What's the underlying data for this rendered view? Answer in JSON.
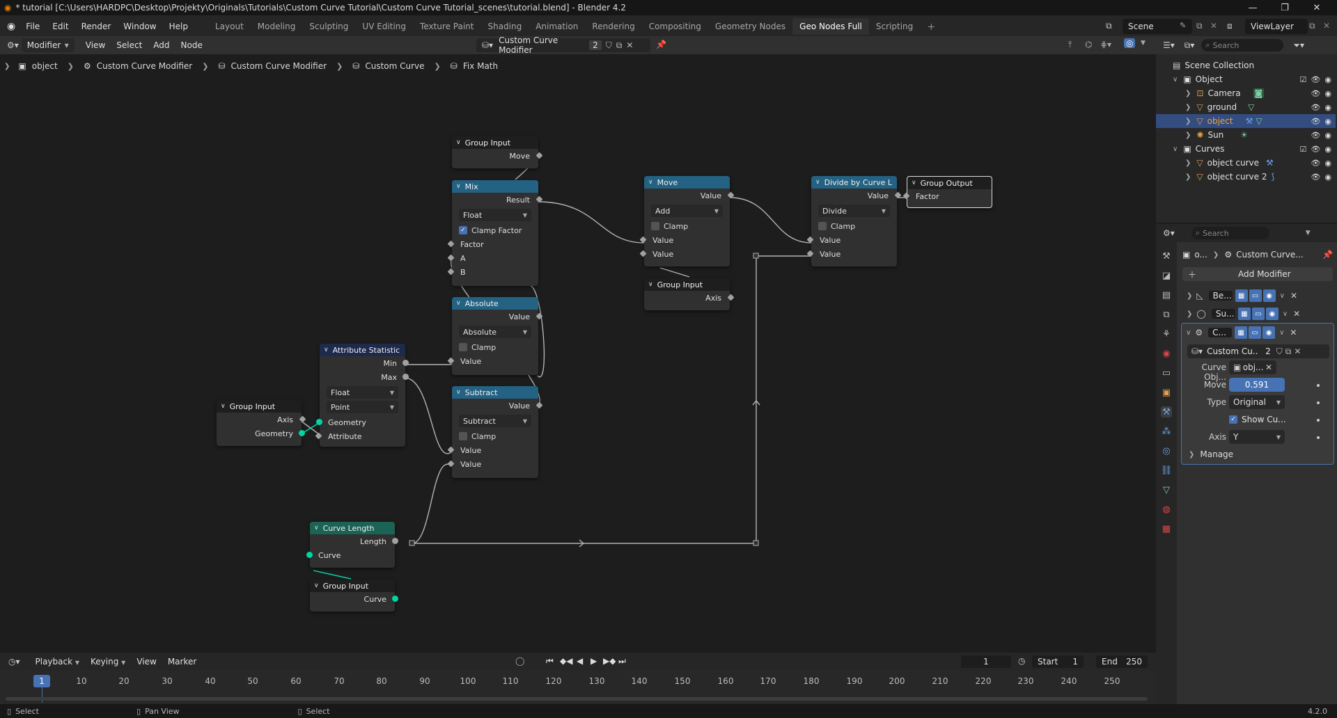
{
  "window": {
    "title": "* tutorial [C:\\Users\\HARDPC\\Desktop\\Projekty\\Originals\\Tutorials\\Custom Curve Tutorial\\Custom Curve Tutorial_scenes\\tutorial.blend] - Blender 4.2"
  },
  "menu": [
    "File",
    "Edit",
    "Render",
    "Window",
    "Help"
  ],
  "workspaces": [
    "Layout",
    "Modeling",
    "Sculpting",
    "UV Editing",
    "Texture Paint",
    "Shading",
    "Animation",
    "Rendering",
    "Compositing",
    "Geometry Nodes",
    "Geo Nodes Full",
    "Scripting"
  ],
  "active_workspace": "Geo Nodes Full",
  "topbar": {
    "scene": "Scene",
    "viewlayer": "ViewLayer"
  },
  "editor_header": {
    "mode": "Modifier",
    "menus": [
      "View",
      "Select",
      "Add",
      "Node"
    ],
    "tree_name": "Custom Curve Modifier",
    "users": "2"
  },
  "breadcrumb": [
    "object",
    "Custom Curve Modifier",
    "Custom Curve Modifier",
    "Custom Curve",
    "Fix Math"
  ],
  "nodes": {
    "group_input_top": {
      "title": "Group Input",
      "out": "Move"
    },
    "mix": {
      "title": "Mix",
      "out": "Result",
      "type": "Float",
      "clamp_factor": "Clamp Factor",
      "in_factor": "Factor",
      "in_a": "A",
      "in_b": "B"
    },
    "absolute": {
      "title": "Absolute",
      "out": "Value",
      "op": "Absolute",
      "clamp": "Clamp",
      "in": "Value"
    },
    "subtract": {
      "title": "Subtract",
      "out": "Value",
      "op": "Subtract",
      "clamp": "Clamp",
      "in1": "Value",
      "in2": "Value"
    },
    "attr_stat": {
      "title": "Attribute Statistic",
      "min": "Min",
      "max": "Max",
      "type": "Float",
      "domain": "Point",
      "in_geo": "Geometry",
      "in_attr": "Attribute"
    },
    "group_input_left": {
      "title": "Group Input",
      "axis": "Axis",
      "geo": "Geometry"
    },
    "move": {
      "title": "Move",
      "out": "Value",
      "op": "Add",
      "clamp": "Clamp",
      "in1": "Value",
      "in2": "Value"
    },
    "group_input_axis": {
      "title": "Group Input",
      "out": "Axis"
    },
    "divide": {
      "title": "Divide by Curve L",
      "out": "Value",
      "op": "Divide",
      "clamp": "Clamp",
      "in1": "Value",
      "in2": "Value"
    },
    "group_output": {
      "title": "Group Output",
      "in": "Factor"
    },
    "curve_length": {
      "title": "Curve Length",
      "out": "Length",
      "in": "Curve"
    },
    "group_input_curve": {
      "title": "Group Input",
      "out": "Curve"
    }
  },
  "outliner": {
    "search_placeholder": "Search",
    "collection": "Scene Collection",
    "rows": [
      {
        "name": "Object",
        "type": "collection"
      },
      {
        "name": "Camera",
        "type": "camera"
      },
      {
        "name": "ground",
        "type": "mesh"
      },
      {
        "name": "object",
        "type": "mesh",
        "selected": true
      },
      {
        "name": "Sun",
        "type": "light"
      },
      {
        "name": "Curves",
        "type": "collection"
      },
      {
        "name": "object curve",
        "type": "curve"
      },
      {
        "name": "object curve 2",
        "type": "curve"
      }
    ]
  },
  "properties": {
    "search_placeholder": "Search",
    "path_obj": "o...",
    "path_mod": "Custom Curve...",
    "add_modifier": "Add Modifier",
    "modifiers": [
      "Be...",
      "Su...",
      "C..."
    ],
    "node_group": "Custom Cu...",
    "node_group_users": "2",
    "fields": {
      "curve_obj_label": "Curve Obj...",
      "curve_obj_value": "obj...",
      "move_label": "Move",
      "move_value": "0.591",
      "type_label": "Type",
      "type_value": "Original",
      "show_label": "Show Cu...",
      "axis_label": "Axis",
      "axis_value": "Y",
      "manage": "Manage"
    }
  },
  "timeline": {
    "menus": [
      "Playback",
      "Keying",
      "View",
      "Marker"
    ],
    "current_frame": "1",
    "start_label": "Start",
    "start": "1",
    "end_label": "End",
    "end": "250",
    "ticks": [
      "10",
      "20",
      "30",
      "40",
      "50",
      "60",
      "70",
      "80",
      "90",
      "100",
      "110",
      "120",
      "130",
      "140",
      "150",
      "160",
      "170",
      "180",
      "190",
      "200",
      "210",
      "220",
      "230",
      "240",
      "250"
    ]
  },
  "statusbar": {
    "left": "Select",
    "mid": "Pan View",
    "right": "Select",
    "version": "4.2.0"
  },
  "colors": {
    "accent": "#4772b3",
    "math_header": "#246283",
    "geo_header": "#1b6354",
    "attr_header": "#1e2a4c",
    "geo_socket": "#00d6a3"
  }
}
